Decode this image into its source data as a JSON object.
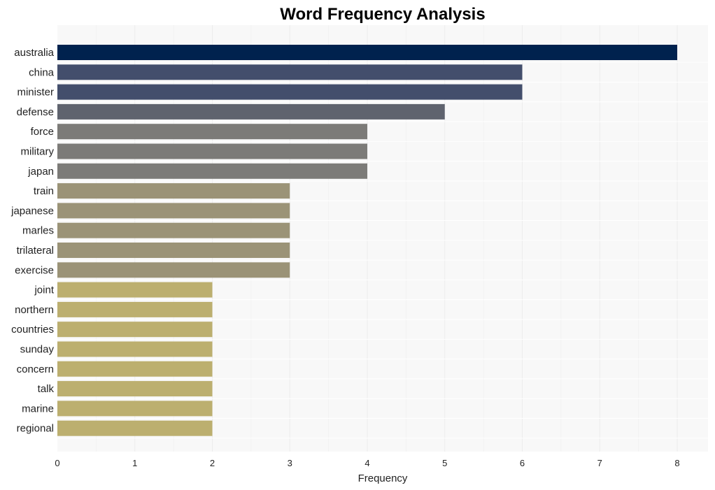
{
  "chart_data": {
    "type": "bar",
    "orientation": "horizontal",
    "title": "Word Frequency Analysis",
    "xlabel": "Frequency",
    "ylabel": "",
    "xlim": [
      0,
      8.4
    ],
    "xticks": [
      0,
      1,
      2,
      3,
      4,
      5,
      6,
      7,
      8
    ],
    "grid": true,
    "categories": [
      "australia",
      "china",
      "minister",
      "defense",
      "force",
      "military",
      "japan",
      "train",
      "japanese",
      "marles",
      "trilateral",
      "exercise",
      "joint",
      "northern",
      "countries",
      "sunday",
      "concern",
      "talk",
      "marine",
      "regional"
    ],
    "values": [
      8,
      6,
      6,
      5,
      4,
      4,
      4,
      3,
      3,
      3,
      3,
      3,
      2,
      2,
      2,
      2,
      2,
      2,
      2,
      2
    ],
    "colors": {
      "8": "#00224e",
      "6": "#434e6c",
      "5": "#5f636e",
      "4": "#7c7b78",
      "3": "#9b9377",
      "2": "#bcaf6f"
    },
    "background": "#f8f8f8"
  }
}
